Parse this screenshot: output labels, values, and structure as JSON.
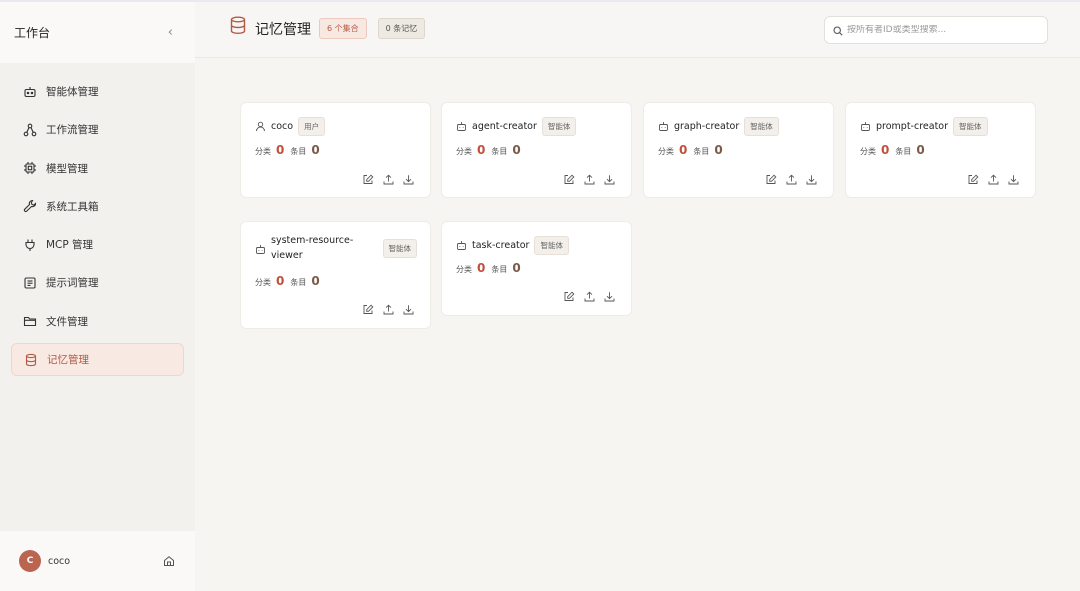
{
  "sidebar": {
    "title": "工作台",
    "collapse_icon": "‹",
    "items": [
      {
        "label": "智能体管理",
        "icon": "robot-icon",
        "active": false
      },
      {
        "label": "工作流管理",
        "icon": "workflow-icon",
        "active": false
      },
      {
        "label": "模型管理",
        "icon": "chip-icon",
        "active": false
      },
      {
        "label": "系统工具箱",
        "icon": "wrench-icon",
        "active": false
      },
      {
        "label": "MCP 管理",
        "icon": "plug-icon",
        "active": false
      },
      {
        "label": "提示词管理",
        "icon": "prompt-icon",
        "active": false
      },
      {
        "label": "文件管理",
        "icon": "folder-icon",
        "active": false
      },
      {
        "label": "记忆管理",
        "icon": "database-icon",
        "active": true
      }
    ],
    "user": {
      "avatar_letter": "C",
      "name": "coco"
    }
  },
  "header": {
    "title": "记忆管理",
    "count_badge": "6 个集合",
    "memory_badge": "0 条记忆",
    "search_placeholder": "按所有者ID或类型搜索..."
  },
  "stats_labels": {
    "category": "分类",
    "entries": "条目"
  },
  "cards": [
    {
      "name": "coco",
      "tag": "用户",
      "type": "user-icon",
      "categories": "0",
      "entries": "0"
    },
    {
      "name": "agent-creator",
      "tag": "智能体",
      "type": "bot-icon",
      "categories": "0",
      "entries": "0"
    },
    {
      "name": "graph-creator",
      "tag": "智能体",
      "type": "bot-icon",
      "categories": "0",
      "entries": "0"
    },
    {
      "name": "prompt-creator",
      "tag": "智能体",
      "type": "bot-icon",
      "categories": "0",
      "entries": "0"
    },
    {
      "name": "system-resource-viewer",
      "name_line1": "system-resource-",
      "name_line2": "viewer",
      "tag": "智能体",
      "type": "bot-icon",
      "categories": "0",
      "entries": "0"
    },
    {
      "name": "task-creator",
      "tag": "智能体",
      "type": "bot-icon",
      "categories": "0",
      "entries": "0"
    }
  ],
  "colors": {
    "accent": "#b35a45",
    "value_red": "#c0503a",
    "active_bg": "#f8e9e3"
  }
}
